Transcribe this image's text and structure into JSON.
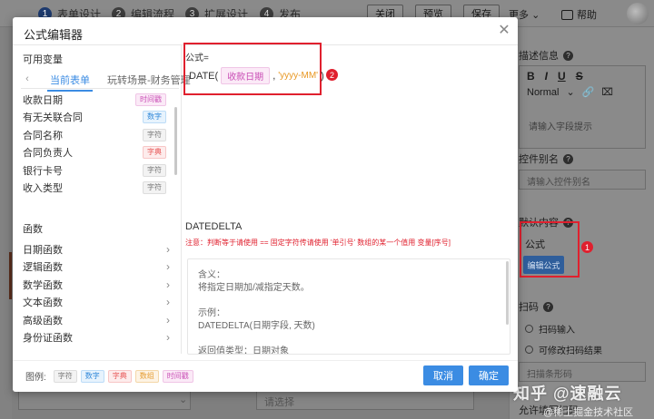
{
  "topbar": {
    "steps": [
      {
        "num": "1",
        "label": "表单设计"
      },
      {
        "num": "2",
        "label": "编辑流程"
      },
      {
        "num": "3",
        "label": "扩展设计"
      },
      {
        "num": "4",
        "label": "发布"
      }
    ],
    "buttons": [
      "关闭",
      "预览",
      "保存"
    ],
    "more_label": "更多",
    "help_label": "帮助"
  },
  "background": {
    "form_select_placeholder": "请选择",
    "right_panel": {
      "desc_label": "描述信息",
      "toolbar_row1": [
        "B",
        "I",
        "U",
        "S"
      ],
      "toolbar_format": "Normal",
      "editor_placeholder": "请输入字段提示",
      "alias_label": "控件别名",
      "alias_placeholder": "请输入控件别名",
      "default_label": "默认内容",
      "formula_label": "公式",
      "formula_button": "编辑公式",
      "scan_label": "扫码",
      "scan_option": "扫码输入",
      "scan_option2": "可修改扫码结果",
      "scan_input_placeholder": "扫描条形码",
      "bottom_label": "允许填写扫码"
    },
    "watermark": "知乎 @速融云",
    "watermark_sub": "@稀土掘金技术社区"
  },
  "modal": {
    "title": "公式编辑器",
    "available_vars_label": "可用变量",
    "tabs": [
      "当前表单",
      "玩转场景-财务管理"
    ],
    "variables": [
      {
        "name": "收款日期",
        "type": "时间戳",
        "kind": "time"
      },
      {
        "name": "有无关联合同",
        "type": "数字",
        "kind": "num"
      },
      {
        "name": "合同名称",
        "type": "字符",
        "kind": "text"
      },
      {
        "name": "合同负责人",
        "type": "字典",
        "kind": "dict"
      },
      {
        "name": "银行卡号",
        "type": "字符",
        "kind": "text"
      },
      {
        "name": "收入类型",
        "type": "字符",
        "kind": "text"
      }
    ],
    "functions_label": "函数",
    "functions": [
      "日期函数",
      "逻辑函数",
      "数学函数",
      "文本函数",
      "高级函数",
      "身份证函数"
    ],
    "legend_label": "图例:",
    "legend": [
      {
        "label": "字符",
        "kind": "text"
      },
      {
        "label": "数字",
        "kind": "num"
      },
      {
        "label": "字典",
        "kind": "dict"
      },
      {
        "label": "数组",
        "kind": "arr"
      },
      {
        "label": "时间戳",
        "kind": "time"
      }
    ],
    "formula_label": "公式=",
    "formula": {
      "fn": "DATE(",
      "field": "收款日期",
      "comma": ",",
      "str": "'yyyy-MM'",
      "close": ")"
    },
    "badge_formula": "2",
    "badge_right": "1",
    "doc": {
      "fn_name": "DATEDELTA",
      "warning": "注意：判断等于请使用 == 固定字符传请使用 '单引号' 数组的某一个值用 变量[序号]",
      "lines": [
        "含义：",
        "将指定日期加/减指定天数。",
        "示例：",
        "DATEDELTA(日期字段, 天数)",
        "返回值类型：日期对象"
      ]
    },
    "cancel_label": "取消",
    "confirm_label": "确定"
  }
}
